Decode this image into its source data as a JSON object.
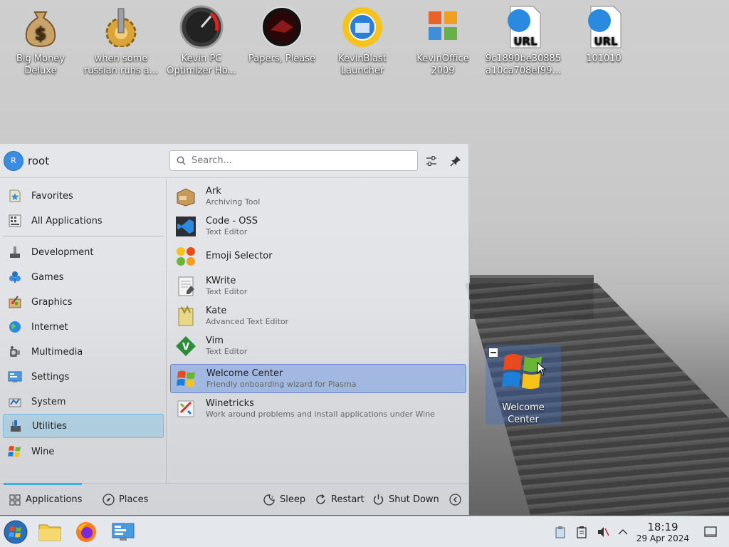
{
  "desktop": {
    "icons": [
      {
        "label": "Big Money Deluxe",
        "icon": "money-bag-icon"
      },
      {
        "label": "when some russian runs a...",
        "icon": "gear-icon"
      },
      {
        "label": "Kevin PC Optimizer Ho...",
        "icon": "speedometer-icon"
      },
      {
        "label": "Papers, Please",
        "icon": "papers-please-icon"
      },
      {
        "label": "KevinBlast Launcher",
        "icon": "sun-globe-icon"
      },
      {
        "label": "KevinOffice 2009",
        "icon": "office-icon"
      },
      {
        "label": "9c1890be30885 a10ca708ef99...",
        "icon": "url-file-icon",
        "badge": "URL"
      },
      {
        "label": "101010",
        "icon": "url-file-icon",
        "badge": "URL"
      }
    ],
    "selected_icon": {
      "label": "Welcome Center",
      "icon": "windows-logo-icon"
    }
  },
  "menu": {
    "user": {
      "initial": "R",
      "name": "root"
    },
    "search": {
      "placeholder": "Search..."
    },
    "categories": [
      {
        "label": "Favorites",
        "icon": "favorites-icon"
      },
      {
        "label": "All Applications",
        "icon": "all-apps-icon"
      },
      {
        "label": "Development",
        "icon": "development-icon"
      },
      {
        "label": "Games",
        "icon": "games-icon"
      },
      {
        "label": "Graphics",
        "icon": "graphics-icon"
      },
      {
        "label": "Internet",
        "icon": "internet-icon"
      },
      {
        "label": "Multimedia",
        "icon": "multimedia-icon"
      },
      {
        "label": "Settings",
        "icon": "settings-icon"
      },
      {
        "label": "System",
        "icon": "system-icon"
      },
      {
        "label": "Utilities",
        "icon": "utilities-icon",
        "selected": true
      },
      {
        "label": "Wine",
        "icon": "wine-icon"
      }
    ],
    "apps": [
      {
        "name": "Ark",
        "desc": "Archiving Tool",
        "icon": "ark-icon"
      },
      {
        "name": "Code - OSS",
        "desc": "Text Editor",
        "icon": "vscode-icon"
      },
      {
        "name": "Emoji Selector",
        "desc": "",
        "icon": "emoji-icon"
      },
      {
        "name": "KWrite",
        "desc": "Text Editor",
        "icon": "kwrite-icon"
      },
      {
        "name": "Kate",
        "desc": "Advanced Text Editor",
        "icon": "kate-icon"
      },
      {
        "name": "Vim",
        "desc": "Text Editor",
        "icon": "vim-icon"
      },
      {
        "name": "Welcome Center",
        "desc": "Friendly onboarding wizard for Plasma",
        "icon": "windows-logo-icon",
        "selected": true
      },
      {
        "name": "Winetricks",
        "desc": "Work around problems and install applications under Wine",
        "icon": "winetricks-icon"
      }
    ],
    "footer": {
      "applications": "Applications",
      "places": "Places",
      "sleep": "Sleep",
      "restart": "Restart",
      "shutdown": "Shut Down"
    }
  },
  "taskbar": {
    "clock_time": "18:19",
    "clock_date": "29 Apr 2024"
  },
  "colors": {
    "accent": "#3daee9",
    "selection": "#3d78e9"
  }
}
